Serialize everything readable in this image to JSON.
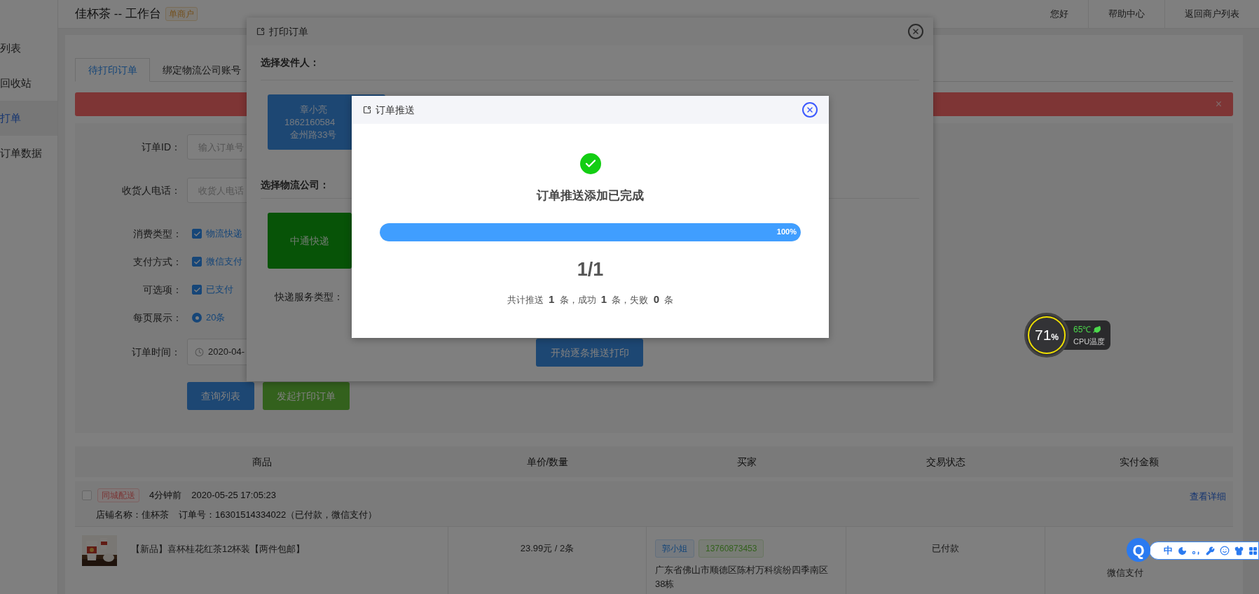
{
  "header": {
    "title": "佳杯茶 -- 工作台",
    "badge": "单商户",
    "nav": [
      "您好",
      "帮助中心",
      "返回商户列表"
    ]
  },
  "sidebar": {
    "items": [
      {
        "label": "列表",
        "selected": false
      },
      {
        "label": "回收站",
        "selected": false
      },
      {
        "label": "打单",
        "selected": true
      },
      {
        "label": "订单数据",
        "selected": false
      }
    ]
  },
  "tabs": [
    {
      "label": "待打印订单",
      "selected": true
    },
    {
      "label": "绑定物流公司账号",
      "selected": false
    }
  ],
  "alert": {
    "close": "×"
  },
  "filters": {
    "order_id": {
      "label": "订单ID：",
      "placeholder": "输入订单号"
    },
    "phone": {
      "label": "收货人电话：",
      "placeholder": "收货人电话"
    },
    "options": [
      {
        "label": "消费类型：",
        "kind": "checkbox",
        "text": "物流快递",
        "checked": true
      },
      {
        "label": "支付方式：",
        "kind": "checkbox",
        "text": "微信支付",
        "checked": true
      },
      {
        "label": "可选项：",
        "kind": "checkbox",
        "text": "已支付",
        "checked": true
      },
      {
        "label": "每页展示：",
        "kind": "radio",
        "text": "20条",
        "checked": true
      }
    ],
    "date": {
      "label": "订单时间：",
      "value": "2020-04-"
    },
    "buttons": [
      "查询列表",
      "发起打印订单"
    ]
  },
  "table": {
    "columns": [
      "商品",
      "单价/数量",
      "买家",
      "交易状态",
      "实付金额"
    ],
    "order": {
      "checked": false,
      "tag": "同城配送",
      "ago": "4分钟前",
      "time": "2020-05-25 17:05:23",
      "shop": "店铺名称：佳杯茶",
      "order_no": "订单号：16301514334022（已付款，微信支付）",
      "detail_link": "查看详细",
      "item": {
        "name": "【新品】喜杯桂花红茶12杯装【两件包邮】",
        "price": "23.99元 / 2条",
        "buyer": "郭小姐",
        "phone": "13760873453",
        "address": "广东省佛山市顺德区陈村万科缤纷四季南区38栋",
        "status": "已付款",
        "payment": "微信支付"
      }
    }
  },
  "print_modal": {
    "title": "打印订单",
    "sender_label": "选择发件人：",
    "sender": {
      "name": "章小亮",
      "phone": "1862160584",
      "address": "金州路33号"
    },
    "carrier_label": "选择物流公司：",
    "carrier": {
      "name": "中通快递",
      "selected": true
    },
    "service_label": "快递服务类型：",
    "start_button": "开始逐条推送打印"
  },
  "push_dialog": {
    "title": "订单推送",
    "message": "订单推送添加已完成",
    "progress": {
      "level": 1,
      "label": "100%"
    },
    "count": "1/1",
    "summary": "共计推送 **1** 条，成功 **1** 条，失败 **0** 条"
  },
  "cpu_widget": {
    "usage": "71",
    "unit": "%",
    "temp": "65℃",
    "label": "CPU温度"
  },
  "ime_toolbar": {
    "logo": "Q",
    "mode": "中"
  }
}
